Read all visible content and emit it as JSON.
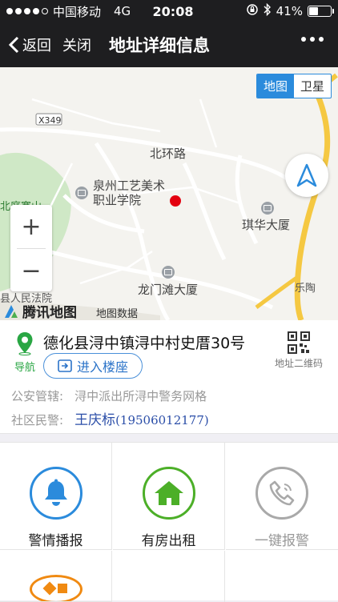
{
  "status": {
    "carrier": "中国移动",
    "network": "4G",
    "time": "20:08",
    "battery": "41%",
    "battery_level": 0.41
  },
  "nav": {
    "back": "返回",
    "close": "关闭",
    "title": "地址详细信息"
  },
  "map": {
    "types": [
      "地图",
      "卫星"
    ],
    "labels": {
      "x349": "X349",
      "beihuan": "北环路",
      "college1": "泉州工艺美术",
      "college2": "职业学院",
      "qihua": "琪华大厦",
      "longmen": "龙门滩大厦",
      "lecao": "乐陶",
      "beiyuan": "北庭寨山",
      "court": "县人民法院"
    },
    "brand": "腾讯地图",
    "map_data": "地图数据"
  },
  "info": {
    "nav_label": "导航",
    "address": "德化县浔中镇浔中村史厝30号",
    "qr_label": "地址二维码",
    "enter_building": "进入楼座",
    "police_jurisdiction_label": "公安管辖:",
    "police_jurisdiction_value": "浔中派出所浔中警务网格",
    "community_police_label": "社区民警:",
    "community_police_name": "王庆标",
    "community_police_phone": "(19506012177)"
  },
  "actions": [
    {
      "label": "警情播报",
      "color": "#2b8bdc",
      "icon": "bell-icon"
    },
    {
      "label": "有房出租",
      "color": "#4caf28",
      "icon": "house-icon"
    },
    {
      "label": "一键报警",
      "color": "#a9a9a9",
      "icon": "phone-icon"
    },
    {
      "label": "",
      "color": "#f08a12",
      "icon": "diamond-icon"
    }
  ]
}
